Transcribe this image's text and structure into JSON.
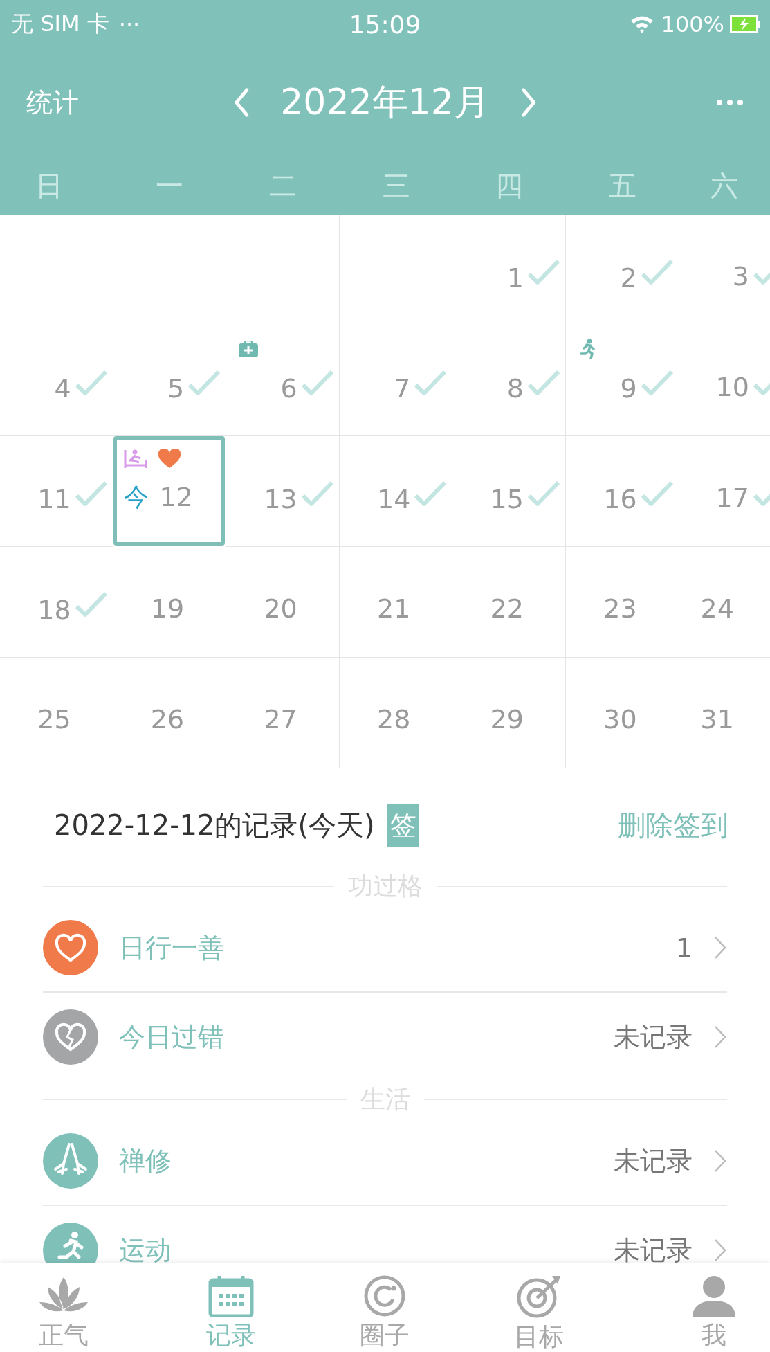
{
  "status_bar": {
    "carrier": "无 SIM 卡",
    "more": "···",
    "time": "15:09",
    "battery": "100%"
  },
  "header": {
    "left": "统计",
    "title": "2022年12月"
  },
  "weekdays": [
    "日",
    "一",
    "二",
    "三",
    "四",
    "五",
    "六"
  ],
  "calendar": {
    "weeks": [
      [
        {
          "kind": "empty"
        },
        {
          "kind": "empty"
        },
        {
          "kind": "empty"
        },
        {
          "kind": "empty"
        },
        {
          "kind": "day",
          "day": "1",
          "checked": true,
          "selected": false
        },
        {
          "kind": "day",
          "day": "2",
          "checked": true,
          "selected": false
        },
        {
          "kind": "day",
          "day": "3",
          "checked": true,
          "selected": false
        }
      ],
      [
        {
          "kind": "day",
          "day": "4",
          "checked": true,
          "selected": false
        },
        {
          "kind": "day",
          "day": "5",
          "checked": true,
          "selected": false
        },
        {
          "kind": "day",
          "day": "6",
          "checked": true,
          "selected": false,
          "markers": [
            {
              "kind": "medical"
            }
          ]
        },
        {
          "kind": "day",
          "day": "7",
          "checked": true,
          "selected": false
        },
        {
          "kind": "day",
          "day": "8",
          "checked": true,
          "selected": false
        },
        {
          "kind": "day",
          "day": "9",
          "checked": true,
          "selected": false,
          "markers": [
            {
              "kind": "running"
            }
          ]
        },
        {
          "kind": "day",
          "day": "10",
          "checked": true,
          "selected": false
        }
      ],
      [
        {
          "kind": "day",
          "day": "11",
          "checked": true,
          "selected": false
        },
        {
          "kind": "day",
          "day": "12",
          "checked": false,
          "selected": true,
          "today_label": "今",
          "markers": [
            {
              "kind": "yoga"
            },
            {
              "kind": "heart"
            }
          ]
        },
        {
          "kind": "day",
          "day": "13",
          "checked": true,
          "selected": false
        },
        {
          "kind": "day",
          "day": "14",
          "checked": true,
          "selected": false
        },
        {
          "kind": "day",
          "day": "15",
          "checked": true,
          "selected": false
        },
        {
          "kind": "day",
          "day": "16",
          "checked": true,
          "selected": false
        },
        {
          "kind": "day",
          "day": "17",
          "checked": true,
          "selected": false
        }
      ],
      [
        {
          "kind": "day",
          "day": "18",
          "checked": true,
          "selected": false
        },
        {
          "kind": "day",
          "day": "19",
          "checked": false,
          "selected": false
        },
        {
          "kind": "day",
          "day": "20",
          "checked": false,
          "selected": false
        },
        {
          "kind": "day",
          "day": "21",
          "checked": false,
          "selected": false
        },
        {
          "kind": "day",
          "day": "22",
          "checked": false,
          "selected": false
        },
        {
          "kind": "day",
          "day": "23",
          "checked": false,
          "selected": false
        },
        {
          "kind": "day",
          "day": "24",
          "checked": false,
          "selected": false
        }
      ],
      [
        {
          "kind": "day",
          "day": "25",
          "checked": false,
          "selected": false
        },
        {
          "kind": "day",
          "day": "26",
          "checked": false,
          "selected": false
        },
        {
          "kind": "day",
          "day": "27",
          "checked": false,
          "selected": false
        },
        {
          "kind": "day",
          "day": "28",
          "checked": false,
          "selected": false
        },
        {
          "kind": "day",
          "day": "29",
          "checked": false,
          "selected": false
        },
        {
          "kind": "day",
          "day": "30",
          "checked": false,
          "selected": false
        },
        {
          "kind": "day",
          "day": "31",
          "checked": false,
          "selected": false
        }
      ]
    ]
  },
  "record": {
    "title": "2022-12-12的记录(今天)",
    "badge": "签",
    "action": "删除签到",
    "sections": [
      {
        "label": "功过格",
        "items": [
          {
            "label": "日行一善",
            "value": "1",
            "kind": "heart",
            "color": "#f07a4a"
          },
          {
            "label": "今日过错",
            "value": "未记录",
            "kind": "broken-heart",
            "color": "#a3a5a6"
          }
        ]
      },
      {
        "label": "生活",
        "items": [
          {
            "label": "禅修",
            "value": "未记录",
            "kind": "hands",
            "color": "#7fc1b9"
          },
          {
            "label": "运动",
            "value": "未记录",
            "kind": "runner",
            "color": "#7fc1b9"
          }
        ]
      }
    ]
  },
  "bottom_nav": [
    {
      "label": "正气",
      "kind": "lotus",
      "selected": false
    },
    {
      "label": "记录",
      "kind": "calendar",
      "selected": true
    },
    {
      "label": "圈子",
      "kind": "circle",
      "selected": false
    },
    {
      "label": "目标",
      "kind": "target",
      "selected": false
    },
    {
      "label": "我",
      "kind": "person",
      "selected": false
    }
  ]
}
